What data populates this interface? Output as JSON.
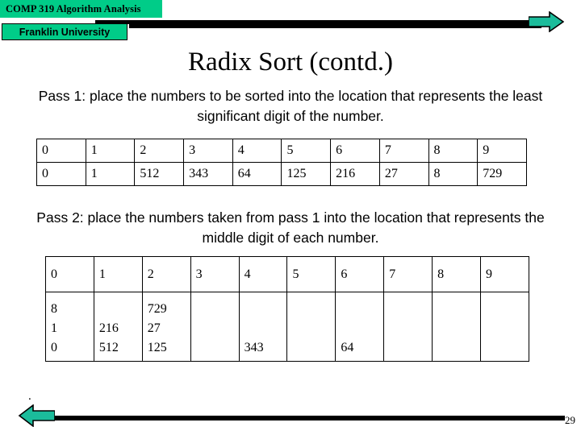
{
  "header": {
    "course_title": "COMP 319  Algorithm Analysis",
    "university": "Franklin University",
    "banner_color": "#00CC88",
    "arrow_right_icon": "arrow-right-icon"
  },
  "slide": {
    "title": "Radix Sort (contd.)",
    "pass1_text": "Pass 1: place the numbers to be sorted into the location that represents the least significant digit of the number.",
    "pass2_text": "Pass 2: place the numbers taken from pass 1 into the location that represents the middle digit of each number.",
    "trailing_period": "."
  },
  "table_pass1": {
    "headers": [
      "0",
      "1",
      "2",
      "3",
      "4",
      "5",
      "6",
      "7",
      "8",
      "9"
    ],
    "values": [
      "0",
      "1",
      "512",
      "343",
      "64",
      "125",
      "216",
      "27",
      "8",
      "729"
    ]
  },
  "table_pass2": {
    "headers": [
      "0",
      "1",
      "2",
      "3",
      "4",
      "5",
      "6",
      "7",
      "8",
      "9"
    ],
    "columns": [
      [
        "8",
        "1",
        "0"
      ],
      [
        "",
        "216",
        "512"
      ],
      [
        "729",
        "27",
        "125"
      ],
      [
        "",
        "",
        ""
      ],
      [
        "",
        "",
        "343"
      ],
      [
        "",
        "",
        ""
      ],
      [
        "",
        "",
        "64"
      ],
      [
        "",
        "",
        ""
      ],
      [
        "",
        "",
        ""
      ],
      [
        "",
        "",
        ""
      ]
    ]
  },
  "footer": {
    "page_number": "29",
    "arrow_left_icon": "arrow-left-icon",
    "bar_color": "#000000"
  }
}
